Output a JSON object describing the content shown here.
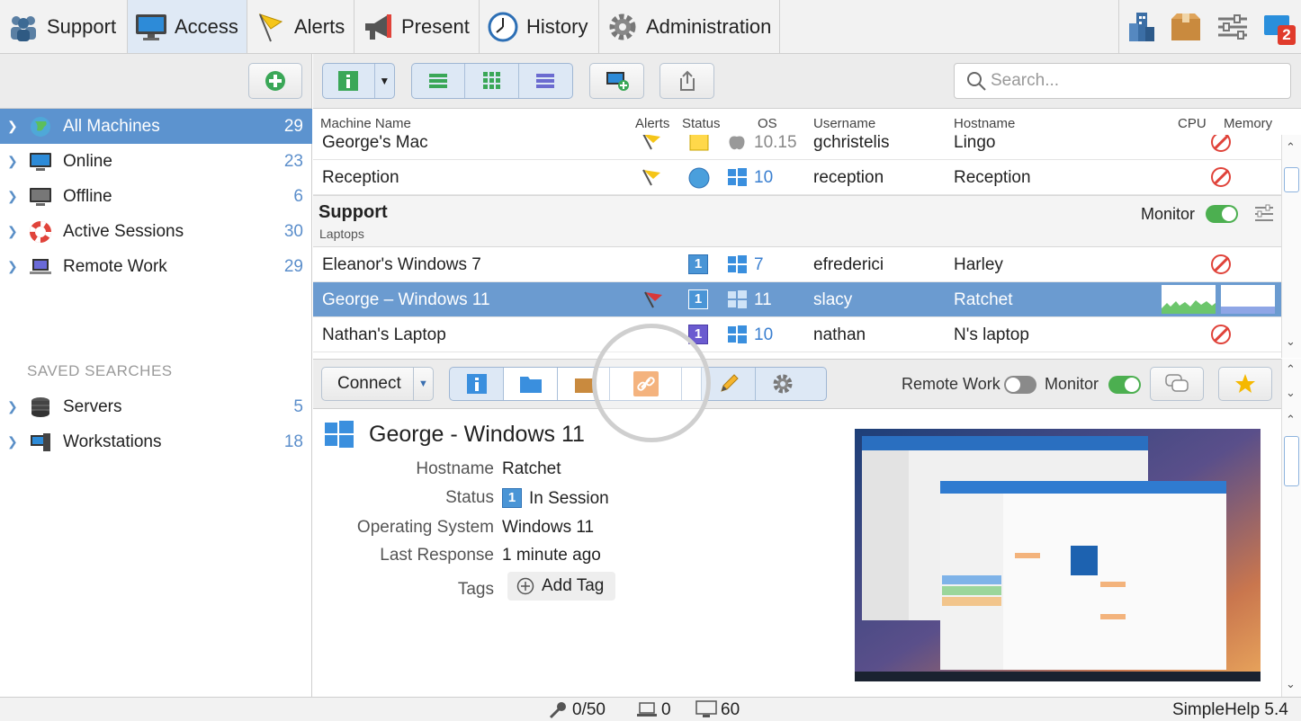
{
  "tabs": [
    {
      "label": "Support",
      "icon": "support-icon"
    },
    {
      "label": "Access",
      "icon": "monitor-icon"
    },
    {
      "label": "Alerts",
      "icon": "flag-icon"
    },
    {
      "label": "Present",
      "icon": "megaphone-icon"
    },
    {
      "label": "History",
      "icon": "clock-icon"
    },
    {
      "label": "Administration",
      "icon": "gear-icon"
    }
  ],
  "top_icons": {
    "badge_count": "2"
  },
  "sidebar": {
    "items": [
      {
        "label": "All Machines",
        "count": "29"
      },
      {
        "label": "Online",
        "count": "23"
      },
      {
        "label": "Offline",
        "count": "6"
      },
      {
        "label": "Active Sessions",
        "count": "30"
      },
      {
        "label": "Remote Work",
        "count": "29"
      }
    ],
    "saved_header": "SAVED SEARCHES",
    "saved": [
      {
        "label": "Servers",
        "count": "5"
      },
      {
        "label": "Workstations",
        "count": "18"
      }
    ]
  },
  "search": {
    "placeholder": "Search..."
  },
  "columns": {
    "name": "Machine Name",
    "alerts": "Alerts",
    "status": "Status",
    "os": "OS",
    "username": "Username",
    "hostname": "Hostname",
    "cpu": "CPU",
    "memory": "Memory"
  },
  "rows_top": [
    {
      "name": "George's Mac",
      "os": "10.15",
      "username": "gchristelis",
      "hostname": "Lingo"
    },
    {
      "name": "Reception",
      "os": "10",
      "username": "reception",
      "hostname": "Reception"
    }
  ],
  "group": {
    "title": "Support",
    "subtitle": "Laptops",
    "monitor_label": "Monitor"
  },
  "rows_group": [
    {
      "name": "Eleanor's Windows 7",
      "status": "1",
      "os": "7",
      "username": "efrederici",
      "hostname": "Harley"
    },
    {
      "name": "George – Windows 11",
      "status": "1",
      "os": "11",
      "username": "slacy",
      "hostname": "Ratchet"
    },
    {
      "name": "Nathan's Laptop",
      "status": "1",
      "os": "10",
      "username": "nathan",
      "hostname": "N's laptop"
    }
  ],
  "connect": {
    "label": "Connect",
    "remote_work": "Remote Work",
    "monitor": "Monitor"
  },
  "detail": {
    "title": "George - Windows 11",
    "fields": [
      {
        "label": "Hostname",
        "value": "Ratchet"
      },
      {
        "label": "Status",
        "value": "In Session",
        "badge": "1"
      },
      {
        "label": "Operating System",
        "value": "Windows 11"
      },
      {
        "label": "Last Response",
        "value": "1 minute ago"
      },
      {
        "label": "Tags",
        "value": "Add Tag"
      }
    ]
  },
  "statusbar": {
    "licenses": "0/50",
    "laptops": "0",
    "monitors": "60",
    "version": "SimpleHelp 5.4"
  }
}
